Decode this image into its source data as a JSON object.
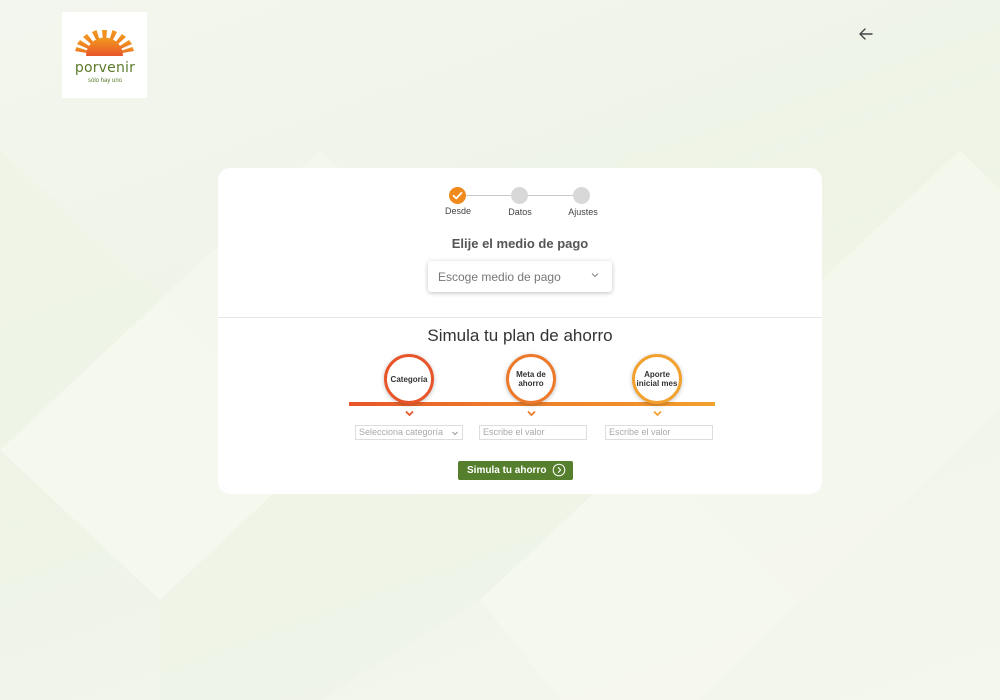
{
  "brand": {
    "name": "porvenir",
    "tagline": "sólo hay uno",
    "colors": {
      "orange": "#f08a1c",
      "green": "#557f2d",
      "red": "#e8552a"
    }
  },
  "header": {
    "back_icon": "arrow-left-icon"
  },
  "stepper": {
    "steps": [
      {
        "label": "Desde",
        "state": "completed"
      },
      {
        "label": "Datos",
        "state": "pending"
      },
      {
        "label": "Ajustes",
        "state": "pending"
      }
    ]
  },
  "payment": {
    "title": "Elije el medio de pago",
    "select_placeholder": "Escoge medio de pago"
  },
  "simulator": {
    "title": "Simula tu plan de ahorro",
    "circles": [
      {
        "label": "Categoría"
      },
      {
        "label": "Meta de ahorro"
      },
      {
        "label": "Aporte inicial mes"
      }
    ],
    "fields": [
      {
        "placeholder": "Selecciona categoría",
        "type": "select"
      },
      {
        "placeholder": "Escribe el valor",
        "type": "input"
      },
      {
        "placeholder": "Escribe el valor",
        "type": "input"
      }
    ],
    "button_label": "Simula tu ahorro"
  }
}
